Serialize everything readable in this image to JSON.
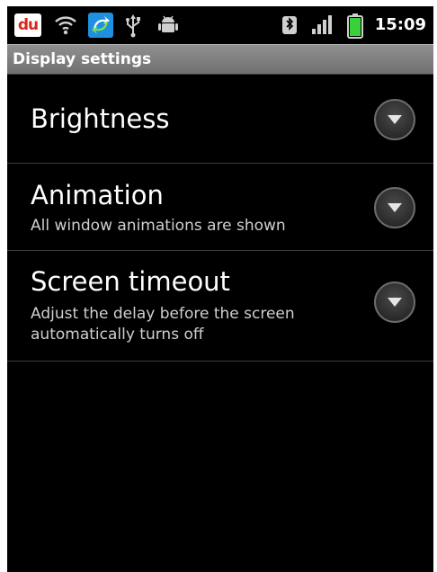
{
  "status_bar": {
    "app_badge": "du",
    "time": "15:09",
    "icons": [
      "du-app-icon",
      "wifi-icon",
      "sync-icon",
      "usb-icon",
      "android-debug-icon",
      "bluetooth-icon",
      "signal-icon",
      "battery-icon"
    ]
  },
  "title_bar": {
    "title": "Display settings"
  },
  "settings": {
    "brightness": {
      "title": "Brightness"
    },
    "animation": {
      "title": "Animation",
      "summary": "All window animations are shown"
    },
    "screen_timeout": {
      "title": "Screen timeout",
      "summary": "Adjust the delay before the screen automatically turns off"
    }
  },
  "colors": {
    "background": "#000000",
    "title_bar": "#808080",
    "text_primary": "#ffffff",
    "text_secondary": "#cfcfcf",
    "divider": "#3b3b3b",
    "battery": "#39d13a"
  }
}
